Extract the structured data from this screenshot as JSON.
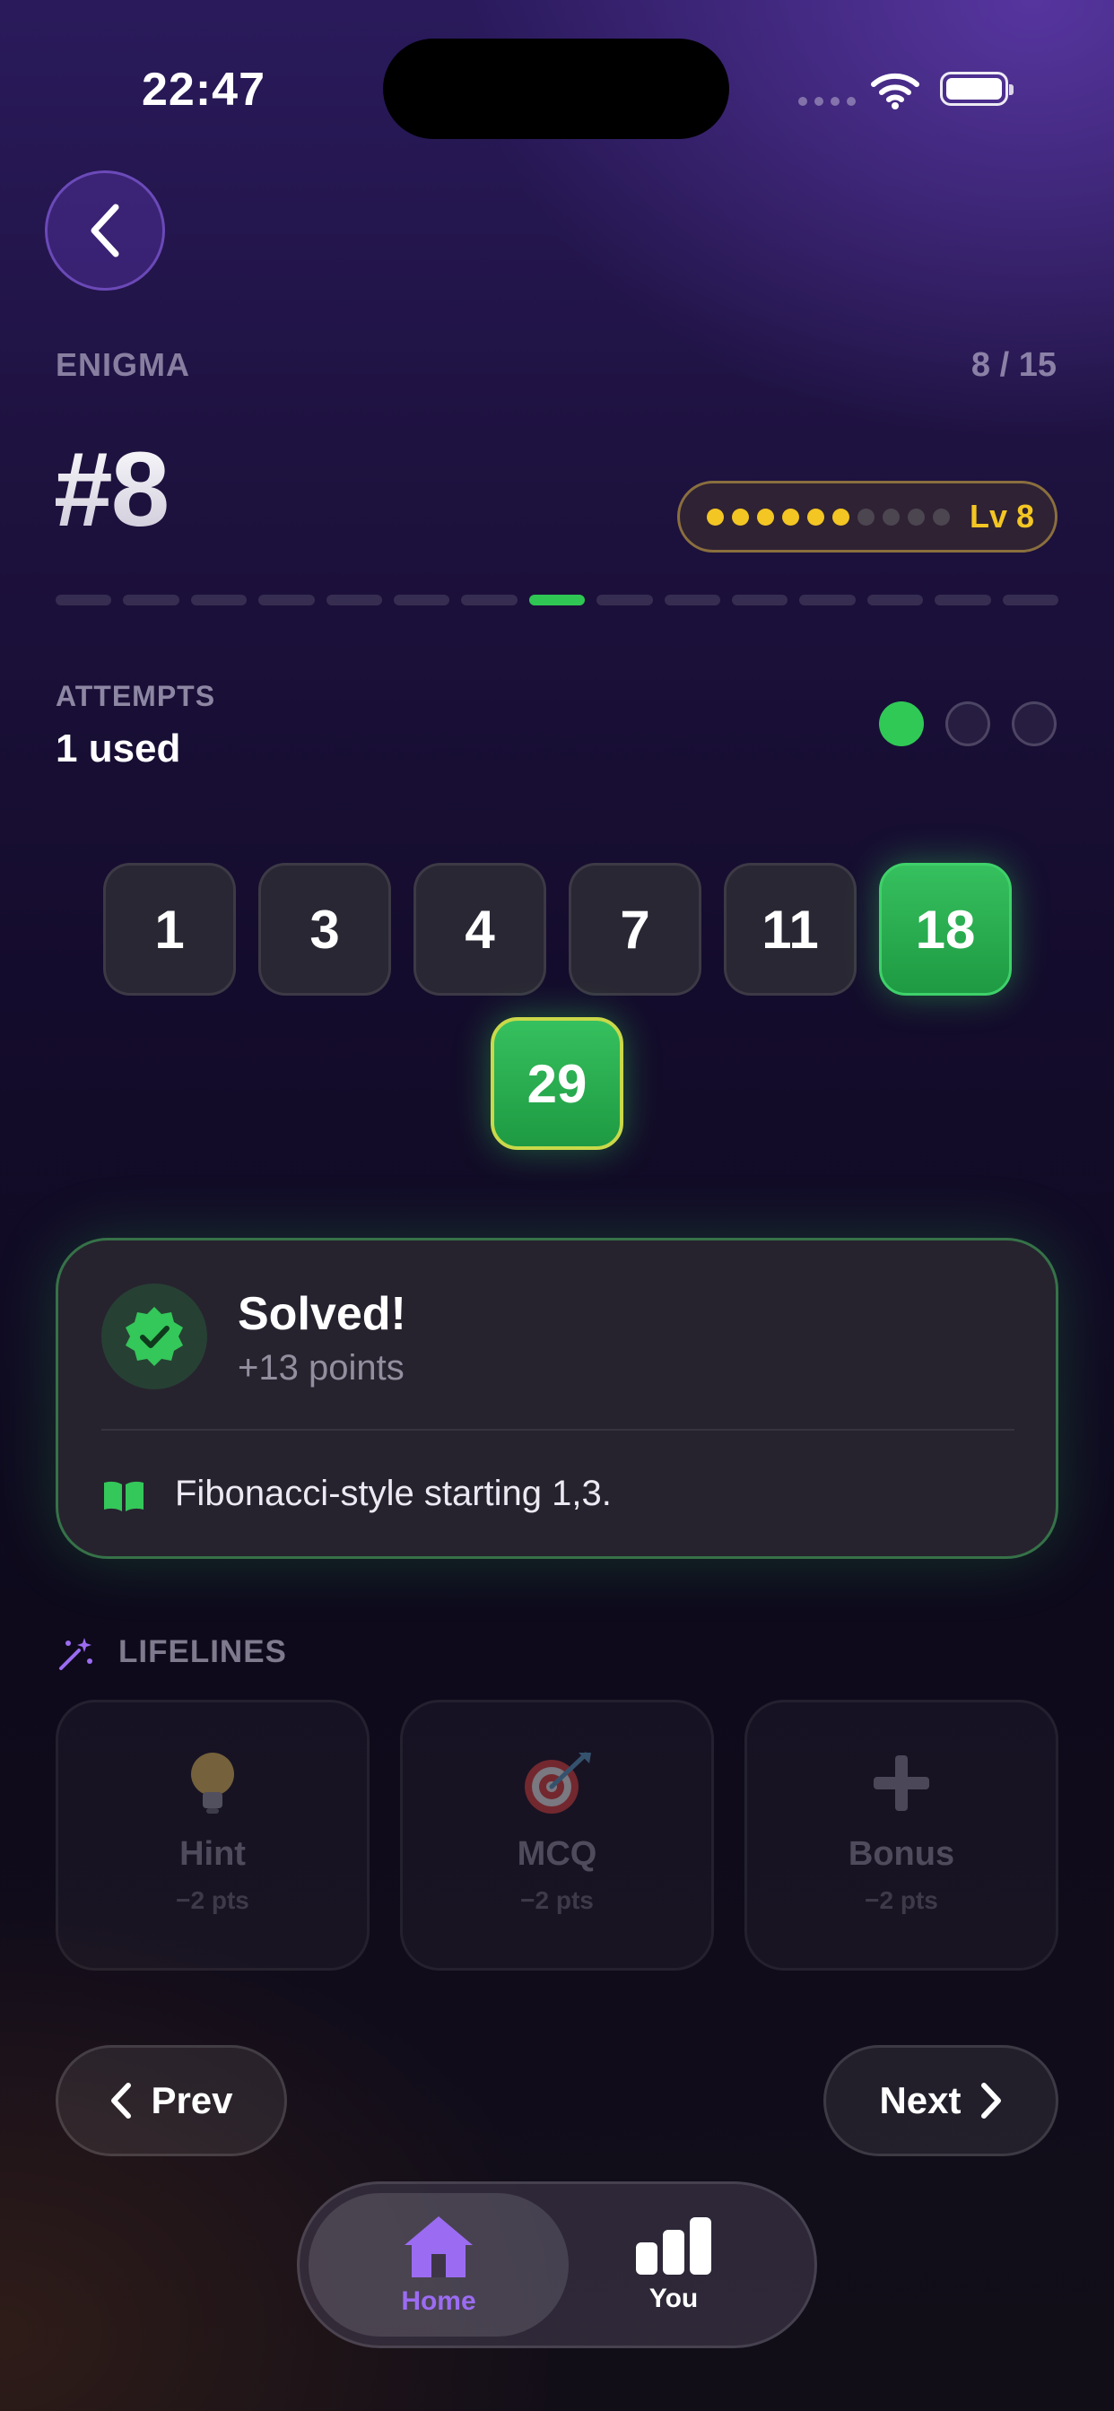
{
  "status_bar": {
    "time": "22:47"
  },
  "header": {
    "kicker": "ENIGMA",
    "counter": "8 / 15",
    "puzzle_number": "#8"
  },
  "level": {
    "label": "Lv 8",
    "dots_filled": 6,
    "dots_total": 10,
    "filled_color": "#f3c623",
    "empty_color": "#4c4650"
  },
  "progress": {
    "current": 8,
    "total": 15
  },
  "attempts": {
    "label": "ATTEMPTS",
    "value": "1 used",
    "used": 1,
    "total": 3
  },
  "sequence": {
    "tiles": [
      {
        "value": "1",
        "state": "default"
      },
      {
        "value": "3",
        "state": "default"
      },
      {
        "value": "4",
        "state": "default"
      },
      {
        "value": "7",
        "state": "default"
      },
      {
        "value": "11",
        "state": "default"
      },
      {
        "value": "18",
        "state": "highlight"
      },
      {
        "value": "29",
        "state": "answer"
      }
    ]
  },
  "result": {
    "title": "Solved!",
    "points": "+13 points",
    "explanation": "Fibonacci-style starting 1,3.",
    "icon": "check-badge-icon"
  },
  "lifelines": {
    "label": "LIFELINES",
    "items": [
      {
        "name": "Hint",
        "cost": "−2 pts",
        "icon": "lightbulb-icon"
      },
      {
        "name": "MCQ",
        "cost": "−2 pts",
        "icon": "target-icon"
      },
      {
        "name": "Bonus",
        "cost": "−2 pts",
        "icon": "plus-icon"
      }
    ]
  },
  "navigation": {
    "prev_label": "Prev",
    "next_label": "Next"
  },
  "tabbar": {
    "tabs": [
      {
        "label": "Home",
        "icon": "home-icon",
        "active": true
      },
      {
        "label": "You",
        "icon": "bar-chart-icon",
        "active": false
      }
    ]
  },
  "colors": {
    "accent_green": "#2fc653",
    "accent_purple": "#9b6cf2",
    "gold": "#f3c623"
  }
}
